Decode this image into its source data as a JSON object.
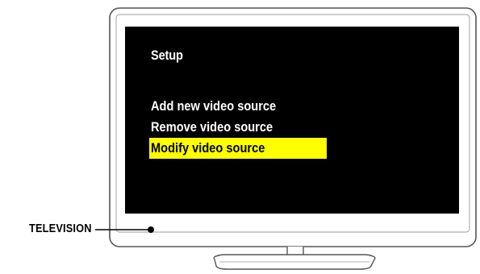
{
  "screen_menu": {
    "title": "Setup",
    "items": [
      {
        "label": "Add new video source",
        "selected": false
      },
      {
        "label": "Remove video source",
        "selected": false
      },
      {
        "label": "Modify video source",
        "selected": true
      }
    ]
  },
  "callout": {
    "label": "TELEVISION"
  },
  "colors": {
    "screen": "#000000",
    "menu_text": "#ffffff",
    "highlight": "#ffff00",
    "highlight_text": "#000000",
    "outline": "#444444"
  }
}
